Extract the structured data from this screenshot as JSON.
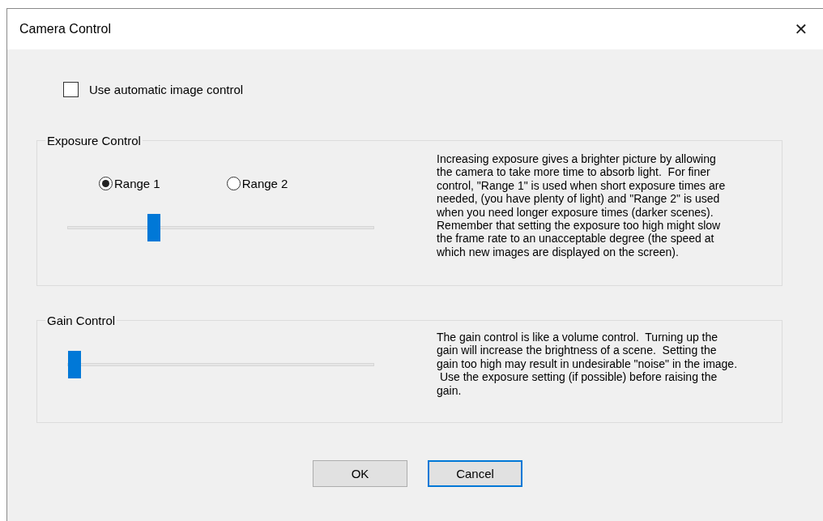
{
  "window": {
    "title": "Camera Control",
    "close": "✕"
  },
  "auto_control": {
    "label": "Use automatic image control",
    "checked": false
  },
  "exposure": {
    "title": "Exposure Control",
    "ranges": [
      {
        "label": "Range 1",
        "selected": true
      },
      {
        "label": "Range 2",
        "selected": false
      }
    ],
    "slider": {
      "level": 0.27
    },
    "description": "Increasing exposure gives a brighter picture by allowing\nthe camera to take more time to absorb light.  For finer\ncontrol, \"Range 1\" is used when short exposure times are\nneeded, (you have plenty of light) and \"Range 2\" is used\nwhen you need longer exposure times (darker scenes).\nRemember that setting the exposure too high might slow\nthe frame rate to an unacceptable degree (the speed at\nwhich new images are displayed on the screen)."
  },
  "gain": {
    "title": "Gain Control",
    "slider": {
      "level": 0
    },
    "description": "The gain control is like a volume control.  Turning up the\ngain will increase the brightness of a scene.  Setting the\ngain too high may result in undesirable \"noise\" in the image.\n Use the exposure setting (if possible) before raising the\ngain."
  },
  "buttons": [
    {
      "label": "OK",
      "default": false
    },
    {
      "label": "Cancel",
      "default": true
    }
  ]
}
